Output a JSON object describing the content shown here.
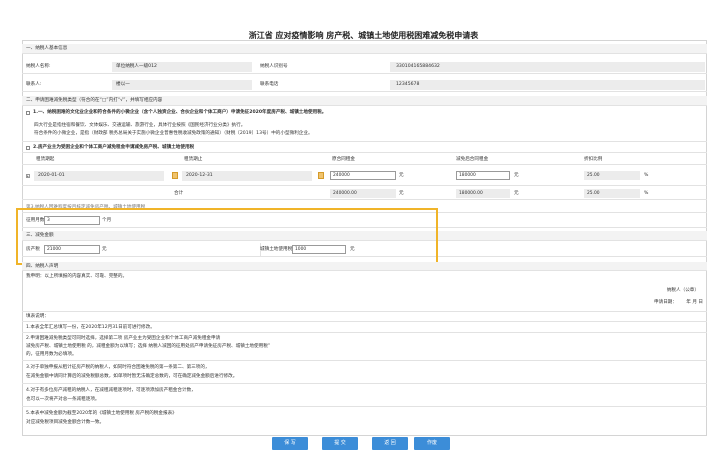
{
  "title": "浙江省 应对疫情影响 房产税、城镇土地使用税困难减免税申请表",
  "section1": {
    "heading": "一、纳税人基本信息",
    "name_label": "纳税人名称:",
    "name_value": "单位纳税人一级012",
    "id_label": "纳税人识别号",
    "id_value": "330104165884632",
    "contact_label": "联系人:",
    "contact_value": "楼以一",
    "phone_label": "联系电话",
    "phone_value": "12345678"
  },
  "section2": {
    "heading": "二、申请困难减免税类型（符合的在“□”内打“√”，并填写相应内容",
    "option1": "1.一、纳税困难的文化业企业和符合条件的小微企业（含个人独资企业、合伙企业和个体工商户）申请免征2020年度房产税、城镇土地使用税。",
    "option1_desc1": "四大行业是指住宿和餐饮、文体娱乐、交通运输、旅游行业，具体行业按照《国民经济行业分类》执行。",
    "option1_desc2": "符合条件的小微企业，是指（财政部 税务总局关于实施小微企业普惠性税收减免政策的通知）（财税〔2019〕13号）中的小型微利企业。",
    "option2": "2.房产业主为受困企业和个体工商户减免租金申请减免房产税、城镇土地使用税"
  },
  "rent_table": {
    "headers": [
      "租赁期起",
      "租赁期止",
      "原合同租金",
      "减免后合同租金",
      "折扣比例"
    ],
    "row": {
      "start": "2020-01-01",
      "end": "2020-12-31",
      "original_rent": "240000",
      "original_unit": "元",
      "reduced_rent": "180000",
      "reduced_unit": "元",
      "ratio": "25.00",
      "ratio_unit": "%"
    },
    "total": {
      "label": "合计",
      "original_rent": "240000.00",
      "original_unit": "元",
      "reduced_rent": "180000.00",
      "reduced_unit": "元",
      "ratio": "25.00",
      "ratio_unit": "%"
    }
  },
  "months": {
    "cut_label": "第3.纳税人困难程度按月核定减免房产税、城镇土地使用税",
    "label": "征用月数",
    "value": "3",
    "unit": "个月"
  },
  "section3": {
    "heading": "三、减免金额",
    "property_label": "房产税",
    "property_value": "21000",
    "property_unit": "元",
    "land_label": "城镇土地使用税",
    "land_value": "1000",
    "land_unit": "元"
  },
  "section4": {
    "heading": "四、纳税人声明",
    "statement": "我申明：以上所填报的内容真实、可靠、完整的。",
    "signature_label": "纳税人（公章）",
    "date_label": "申请日期：",
    "date_suffix": "年 月 日"
  },
  "notes": {
    "title": "填表说明：",
    "items": [
      "1.本表全年汇总填写一份，在2020年12月31日前可进行修改。",
      "2.申请困难减免税类型可同时选择，选择第二项 房产业主为受困企业和个体工商户减免租金申请",
      "减免房产税、城镇土地使用税 的，减租金额为以填写；选择 纳税人减困的征用处房产申请免征房产税、城镇土地使用税”",
      "的，征用月数为必填项。",
      "3.对于单独申报从租计征房产税的纳税人，如同时符合困难免税的第一条第二、第三项的，",
      "在减免金额中请同计算后的减免税额总数，如单项时暂无法确定总数的，可在确定减免金额后进行修改。",
      "4.对于有多位房产减租的纳税人，在减租减租逐项时，可逐项添加房产租金合计数，",
      "也可以一次将产对总一条减租逐项。",
      "5.本表中减免金额为截至2020年的《城镇土地使用税 房产税的税金报表》",
      "对应减免税项目减免金额合计数一致。"
    ]
  },
  "buttons": {
    "save": "保 写",
    "submit": "提 交",
    "back": "返 回",
    "cancel": "作废"
  }
}
